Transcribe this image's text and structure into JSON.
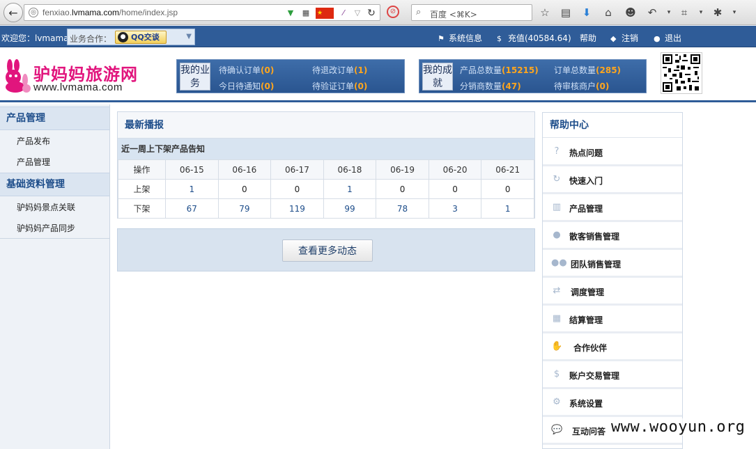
{
  "browser": {
    "url_prefix": "fenxiao.",
    "url_domain": "lvmama.com",
    "url_path": "/home/index.jsp",
    "search_placeholder": "百度 <⌘K>"
  },
  "topbar": {
    "welcome": "欢迎您：lvmama",
    "biz_label": "业务合作：",
    "qq_button": "QQ交谈",
    "nav": [
      {
        "icon": "flag-icon",
        "label": "系统信息"
      },
      {
        "icon": "dollar-icon",
        "label": "充值(40584.64)"
      },
      {
        "icon": "",
        "label": "帮助"
      },
      {
        "icon": "tag-icon",
        "label": "注销"
      },
      {
        "icon": "info-icon",
        "label": "退出"
      }
    ]
  },
  "header": {
    "logo_cn": "驴妈妈旅游网",
    "logo_en": "www.lvmama.com",
    "my_business": {
      "title": "我的业务",
      "items": [
        {
          "label": "待确认订单",
          "count": "(0)"
        },
        {
          "label": "待退改订单",
          "count": "(1)"
        },
        {
          "label": "今日待通知",
          "count": "(0)"
        },
        {
          "label": "待验证订单",
          "count": "(0)"
        }
      ]
    },
    "my_achievement": {
      "title": "我的成就",
      "items": [
        {
          "label": "产品总数量",
          "count": "(15215)"
        },
        {
          "label": "订单总数量",
          "count": "(285)"
        },
        {
          "label": "分销商数量",
          "count": "(47)"
        },
        {
          "label": "待审核商户",
          "count": "(0)"
        }
      ]
    }
  },
  "sidebar": {
    "sections": [
      {
        "title": "产品管理",
        "items": [
          "产品发布",
          "产品管理"
        ]
      },
      {
        "title": "基础资料管理",
        "items": [
          "驴妈妈景点关联",
          "驴妈妈产品同步"
        ]
      }
    ]
  },
  "news": {
    "title": "最新播报",
    "subtitle": "近一周上下架产品告知",
    "header_label": "操作",
    "dates": [
      "06-15",
      "06-16",
      "06-17",
      "06-18",
      "06-19",
      "06-20",
      "06-21"
    ],
    "rows": [
      {
        "label": "上架",
        "values": [
          "1",
          "0",
          "0",
          "1",
          "0",
          "0",
          "0"
        ]
      },
      {
        "label": "下架",
        "values": [
          "67",
          "79",
          "119",
          "99",
          "78",
          "3",
          "1"
        ]
      }
    ],
    "more_button": "查看更多动态"
  },
  "help": {
    "title": "帮助中心",
    "items": [
      {
        "icon": "question-icon",
        "glyph": "?",
        "label": "热点问题"
      },
      {
        "icon": "refresh-icon",
        "glyph": "↻",
        "label": "快速入门"
      },
      {
        "icon": "book-icon",
        "glyph": "▥",
        "label": "产品管理"
      },
      {
        "icon": "user-icon",
        "glyph": "●",
        "label": "散客销售管理"
      },
      {
        "icon": "group-icon",
        "glyph": "●●",
        "label": "团队销售管理"
      },
      {
        "icon": "transfer-icon",
        "glyph": "⇄",
        "label": "调度管理"
      },
      {
        "icon": "calculator-icon",
        "glyph": "▦",
        "label": "结算管理"
      },
      {
        "icon": "handshake-icon",
        "glyph": "✋",
        "label": "合作伙伴"
      },
      {
        "icon": "dollar-icon",
        "glyph": "$",
        "label": "账户交易管理"
      },
      {
        "icon": "gears-icon",
        "glyph": "⚙",
        "label": "系统设置"
      },
      {
        "icon": "chat-icon",
        "glyph": "💬",
        "label": "互动问答"
      }
    ]
  },
  "watermark": "www.wooyun.org"
}
